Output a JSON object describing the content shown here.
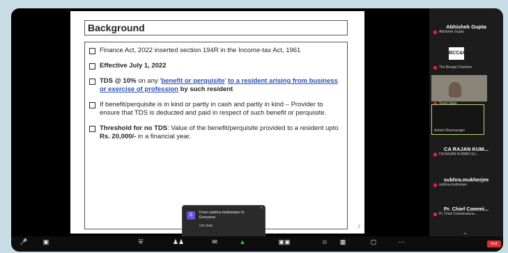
{
  "slide": {
    "title": "Background",
    "bullets": {
      "b1": "Finance Act, 2022 inserted section 194R in the Income-tax Act, 1961",
      "b2": "Effective July 1, 2022",
      "b3_bold": "TDS @ 10%",
      "b3_text": " on any '",
      "b3_link": "benefit or perquisite",
      "b3_mid": "' ",
      "b3_link2": "to a resident arising from business or exercise of profession",
      "b3_end": " by such resident",
      "b4": "If benefit/perquisite is in kind or partly in cash and partly in kind – Provider to ensure that TDS is deducted and paid in respect of such benefit or perquisite.",
      "b5_bold": "Threshold for no TDS",
      "b5_text": ": Value of the benefit/perquisite provided to a resident upto ",
      "b5_amount": "Rs. 20,000/-",
      "b5_end": " in a financial year."
    }
  },
  "participants": [
    {
      "name": "Abhishek Gupta",
      "sub": "Abhishek Gupta"
    },
    {
      "name": "",
      "sub": "The Bengal Chamber",
      "logo": "BCC&I"
    },
    {
      "name": "",
      "sub": "Vivek Jalan"
    },
    {
      "name": "",
      "sub": "Ashok Dharmarajan"
    },
    {
      "name": "CA RAJAN KUM...",
      "sub": "CA RAJAN KUMAR GU..."
    },
    {
      "name": "subhra.mukherjee",
      "sub": "subhra.mukherjee"
    },
    {
      "name": "Pr. Chief Commi...",
      "sub": "Pr. Chief Commissione..."
    }
  ],
  "chat": {
    "avatar": "S",
    "from": "From subhra.mukherjee to Everyone",
    "message": "not clear"
  },
  "toolbar": {
    "end": "End"
  },
  "colors": {
    "end": "#e02d2d",
    "link": "#2b4fb6",
    "active_border": "#b9d76b"
  }
}
